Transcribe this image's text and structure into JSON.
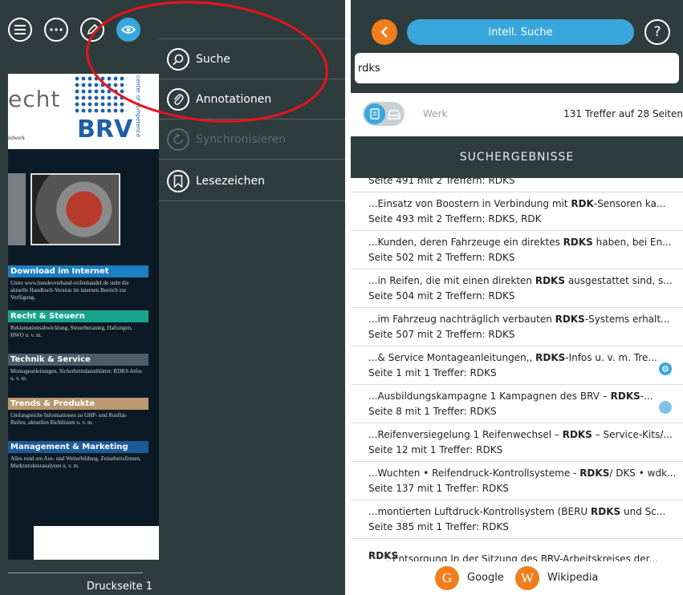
{
  "document": {
    "brand_text": "echt",
    "brand_sub": "ndwerk",
    "logo_text": "BRV",
    "logo_vertical": "center of competence",
    "sections": [
      {
        "title": "Download im Internet",
        "color": "#1c7fc1",
        "text": "Unter www.bundesverband-reifenhandel.de steht die aktuelle Handbuch-Version im internen Bereich zur Verfügung."
      },
      {
        "title": "Recht & Steuern",
        "color": "#1aa38f",
        "text": "Reklamationsabwicklung, Steuerberatung, Haftungen, HWO u. v. m."
      },
      {
        "title": "Technik & Service",
        "color": "#4a5d6a",
        "text": "Montageanleitungen, Sicherheitsdatenblätter, RDKS-Infos u. v. m."
      },
      {
        "title": "Trends & Produkte",
        "color": "#b89a6e",
        "text": "Umfangreiche Informationen zu UHP- und Runflat-Reifen, aktuellen Richtlinien u. v. m."
      },
      {
        "title": "Management & Marketing",
        "color": "#1c5b98",
        "text": "Alles rund um Aus- und Weiterbildung, Zeitarbeitsfirmen, Marktstrukturanalysen u. v. m."
      }
    ],
    "page_label": "Druckseite 1"
  },
  "toolbar": {
    "icons": [
      "menu-icon",
      "more-icon",
      "pen-icon",
      "eye-icon"
    ]
  },
  "drawer": {
    "items": [
      {
        "label": "Suche",
        "icon": "search-icon",
        "enabled": true
      },
      {
        "label": "Annotationen",
        "icon": "paperclip-icon",
        "enabled": true
      },
      {
        "label": "Synchronisieren",
        "icon": "sync-icon",
        "enabled": false
      },
      {
        "label": "Lesezeichen",
        "icon": "bookmark-icon",
        "enabled": true
      }
    ]
  },
  "search": {
    "back_icon": "chevron-left-icon",
    "mode_label": "intell. Suche",
    "help_label": "?",
    "query": "rdks",
    "filter_label": "Werk",
    "result_count": "131 Treffer auf 28 Seiten",
    "results_header": "SUCHERGEBNISSE",
    "first_partial": "Seite 491 mit 2 Treffern: RDKS",
    "results": [
      {
        "pre": "...Einsatz von Boostern in Verbindung mit ",
        "hit": "RDK",
        "post": "-Sensoren ka...",
        "meta": "Seite 493 mit 2 Treffern: RDKS, RDK"
      },
      {
        "pre": "...Kunden, deren Fahrzeuge ein direktes ",
        "hit": "RDKS",
        "post": " haben, bei En...",
        "meta": "Seite 502 mit 2 Treffern: RDKS"
      },
      {
        "pre": "...in Reifen, die mit einen direkten ",
        "hit": "RDKS",
        "post": " ausgestattet sind, s...",
        "meta": "Seite 504 mit 2 Treffern: RDKS"
      },
      {
        "pre": "...im Fahrzeug nachträglich verbauten ",
        "hit": "RDKS",
        "post": "-Systems erhalt...",
        "meta": "Seite 507 mit 2 Treffern: RDKS"
      },
      {
        "pre": "...& Service Montageanleitungen,, ",
        "hit": "RDKS",
        "post": "-Infos u. v. m. Tre...",
        "meta": "Seite 1 mit 1 Treffer: RDKS"
      },
      {
        "pre": "...Ausbildungskampagne 1 Kampagnen des BRV – ",
        "hit": "RDKS",
        "post": "-...",
        "meta": "Seite 8 mit 1 Treffer: RDKS"
      },
      {
        "pre": "...Reifenversiegelung 1 Reifenwechsel – ",
        "hit": "RDKS",
        "post": " – Service-Kits/...",
        "meta": "Seite 12 mit 1 Treffer: RDKS"
      },
      {
        "pre": "...Wuchten • Reifendruck-Kontrollsysteme - ",
        "hit": "RDKS",
        "post": "/ DKS • wdk...",
        "meta": "Seite 137 mit 1 Treffer: RDKS"
      },
      {
        "pre": "...montierten Luftdruck-Kontrollsystem (BERU ",
        "hit": "RDKS",
        "post": " und Sc...",
        "meta": "Seite 385 mit 1 Treffer: RDKS"
      }
    ],
    "last_partial_hit": "RDKS",
    "last_partial_rest": ": Entsorgung In der Sitzung des BRV-Arbeitskreises der...",
    "external": [
      {
        "icon_letter": "G",
        "label": "Google",
        "icon": "google-icon"
      },
      {
        "icon_letter": "W",
        "label": "Wikipedia",
        "icon": "wikipedia-icon"
      }
    ]
  },
  "colors": {
    "dark_bar": "#2f3c3e",
    "accent_blue": "#3aa7dc",
    "accent_orange": "#f07e1e",
    "annotation_red": "#e8141b"
  }
}
